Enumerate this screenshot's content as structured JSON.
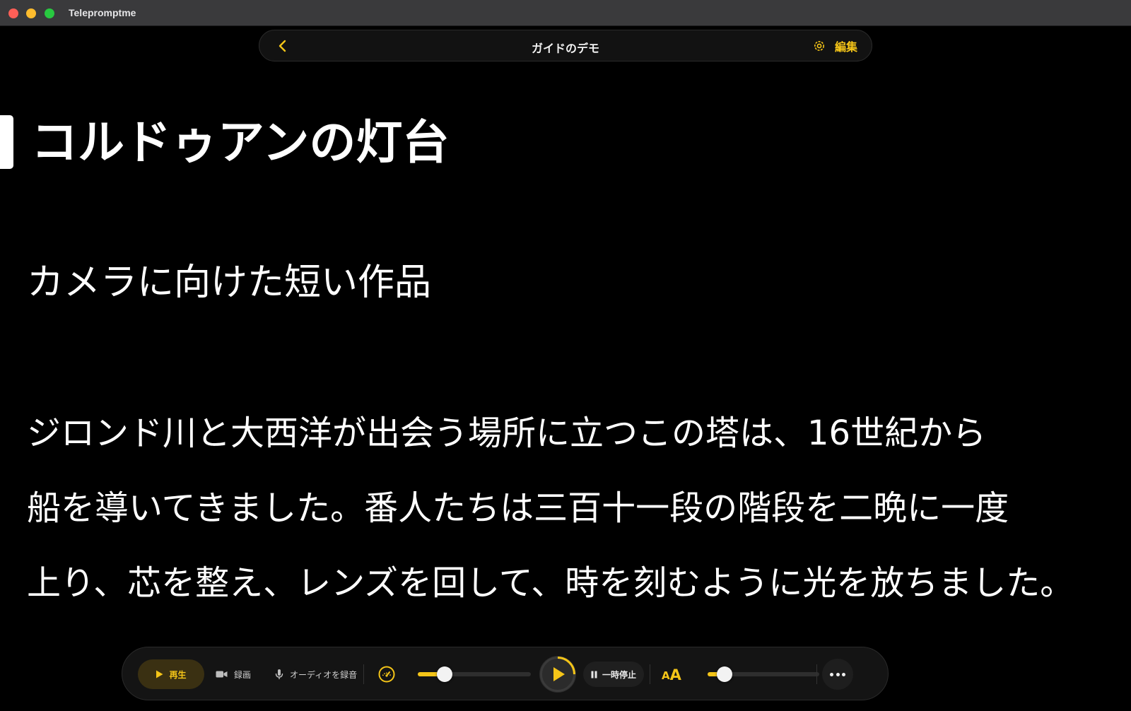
{
  "window": {
    "app_title": "Telepromptme"
  },
  "nav": {
    "title": "ガイドのデモ",
    "edit_label": "編集"
  },
  "script": {
    "title": "コルドゥアンの灯台",
    "subtitle": "カメラに向けた短い作品",
    "body_lines": [
      "ジロンド川と大西洋が出会う場所に立つこの塔は、16世紀から",
      "船を導いてきました。番人たちは三百十一段の階段を二晩に一度",
      "上り、芯を整え、レンズを回して、時を刻むように光を放ちました。"
    ]
  },
  "controls": {
    "mode_play_label": "再生",
    "mode_record_label": "録画",
    "mode_audio_label": "オーディオを録音",
    "speed_level": 0.24,
    "pause_label": "一時停止",
    "font_size_icon": {
      "small": "A",
      "large": "A"
    },
    "font_size_level": 0.15
  },
  "colors": {
    "accent": "#f5c518",
    "background": "#000000",
    "text": "#ffffff"
  },
  "icons": [
    "chevron-left-icon",
    "gear-icon",
    "play-icon",
    "video-camera-icon",
    "microphone-icon",
    "speedometer-icon",
    "pause-icon",
    "font-size-icon",
    "ellipsis-icon"
  ]
}
